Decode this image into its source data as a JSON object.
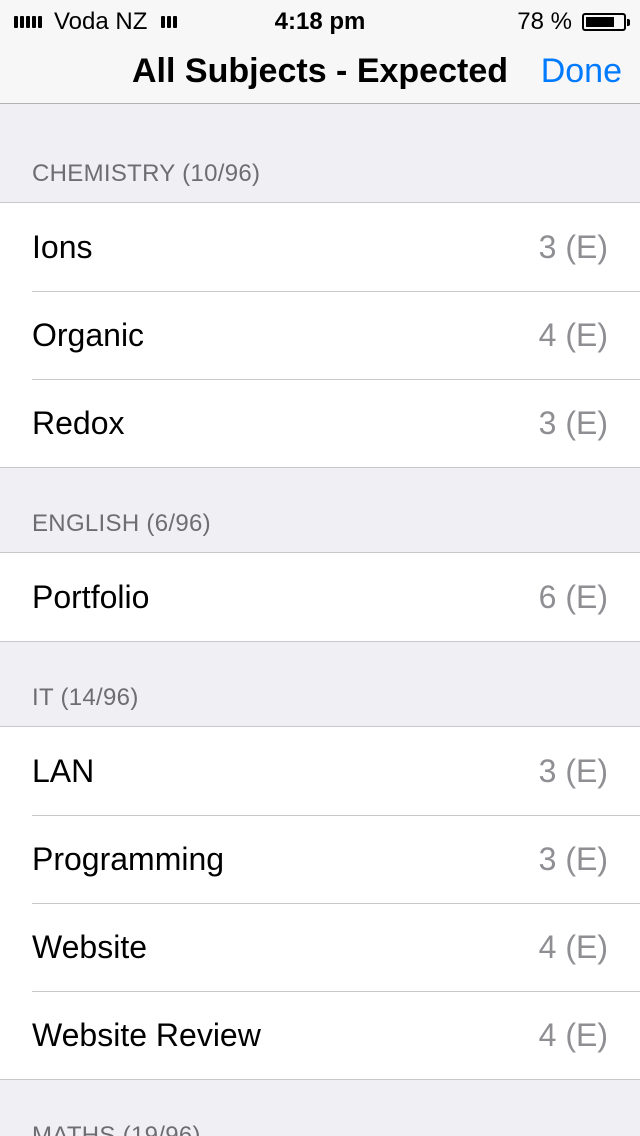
{
  "status_bar": {
    "carrier": "Voda NZ",
    "time": "4:18 pm",
    "battery": "78 %",
    "battery_level": 0.78
  },
  "nav": {
    "title": "All Subjects - Expected",
    "done_label": "Done"
  },
  "sections": [
    {
      "header": "CHEMISTRY (10/96)",
      "rows": [
        {
          "label": "Ions",
          "value": "3 (E)"
        },
        {
          "label": "Organic",
          "value": "4 (E)"
        },
        {
          "label": "Redox",
          "value": "3 (E)"
        }
      ]
    },
    {
      "header": "ENGLISH (6/96)",
      "rows": [
        {
          "label": "Portfolio",
          "value": "6 (E)"
        }
      ]
    },
    {
      "header": "IT (14/96)",
      "rows": [
        {
          "label": "LAN",
          "value": "3 (E)"
        },
        {
          "label": "Programming",
          "value": "3 (E)"
        },
        {
          "label": "Website",
          "value": "4 (E)"
        },
        {
          "label": "Website Review",
          "value": "4 (E)"
        }
      ]
    },
    {
      "header": "MATHS (19/96)",
      "rows": []
    }
  ],
  "colors": {
    "accent": "#007aff",
    "background": "#efeff4",
    "header_text": "#6d6d72",
    "detail_text": "#8e8e93"
  }
}
